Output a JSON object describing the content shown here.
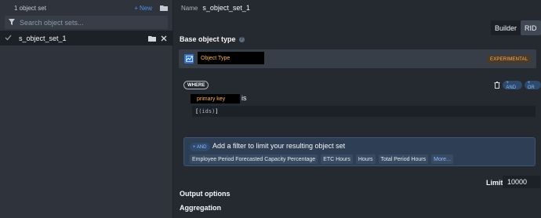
{
  "sidebar": {
    "count_label": "1 object set",
    "new_label": "New",
    "search_placeholder": "Search object sets...",
    "items": [
      {
        "label": "s_object_set_1"
      }
    ]
  },
  "header": {
    "name_label": "Name",
    "name_value": "s_object_set_1"
  },
  "mode_toggle": {
    "builder_label": "Builder",
    "rid_label": "RID",
    "selected": "RID"
  },
  "base_object": {
    "title": "Base object type",
    "object_type_label": "Object Type",
    "badge": "EXPERIMENTAL"
  },
  "where": {
    "pill": "WHERE",
    "and_label": "+ AND",
    "or_label": "+ OR",
    "property_label": "primary key",
    "operator": "is",
    "value_open": "[",
    "value_inner": "(ids)",
    "value_close": "]"
  },
  "filter_hint": {
    "and_label": "+ AND",
    "text": "Add a filter to limit your resulting object set",
    "chips": [
      "Employee Period Forecasted Capacity Percentage",
      "ETC Hours",
      "Hours",
      "Total Period Hours"
    ],
    "more_label": "More..."
  },
  "limit": {
    "label": "Limit",
    "value": "10000"
  },
  "sections": {
    "output_options": "Output options",
    "aggregation": "Aggregation"
  },
  "colors": {
    "accent": "#4c90f0",
    "warning": "#fbb360",
    "background": "#252a31",
    "sidebar": "#2f343c"
  }
}
